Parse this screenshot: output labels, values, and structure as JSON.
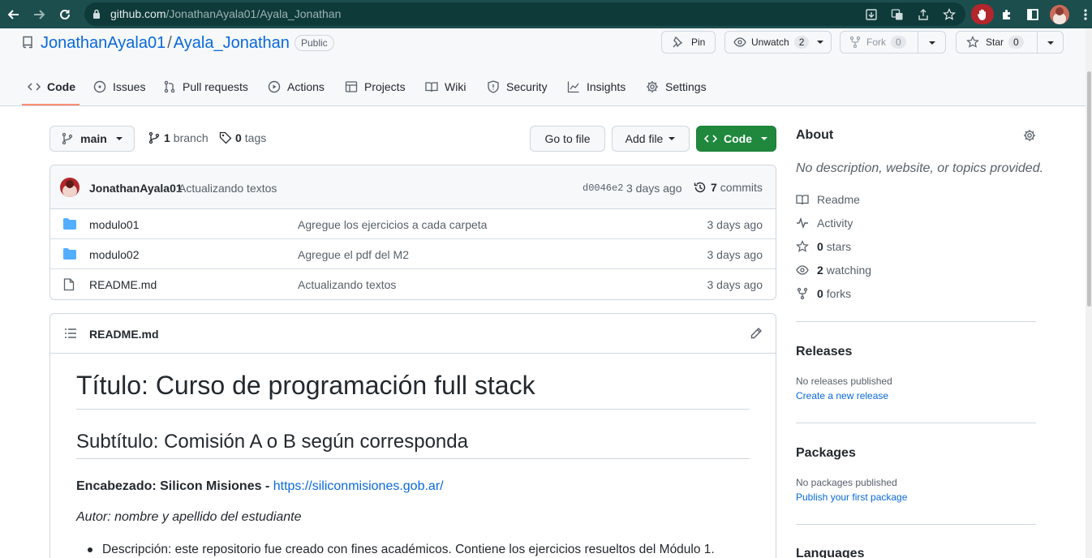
{
  "browser": {
    "url_host": "github.com",
    "url_path": "/JonathanAyala01/Ayala_Jonathan"
  },
  "repo": {
    "owner": "JonathanAyala01",
    "separator": "/",
    "name": "Ayala_Jonathan",
    "visibility": "Public",
    "pin_label": "Pin",
    "unwatch_label": "Unwatch",
    "unwatch_count": "2",
    "fork_label": "Fork",
    "fork_count": "0",
    "star_label": "Star",
    "star_count": "0"
  },
  "tabs": [
    {
      "label": "Code"
    },
    {
      "label": "Issues"
    },
    {
      "label": "Pull requests"
    },
    {
      "label": "Actions"
    },
    {
      "label": "Projects"
    },
    {
      "label": "Wiki"
    },
    {
      "label": "Security"
    },
    {
      "label": "Insights"
    },
    {
      "label": "Settings"
    }
  ],
  "file_nav": {
    "branch": "main",
    "branch_count": "1",
    "branch_label": "branch",
    "tag_count": "0",
    "tag_label": "tags",
    "goto_label": "Go to file",
    "add_file_label": "Add file",
    "code_label": "Code"
  },
  "commit": {
    "author": "JonathanAyala01",
    "message": "Actualizando textos",
    "sha": "d0046e2",
    "age": "3 days ago",
    "commit_count": "7",
    "commit_label": "commits"
  },
  "files": [
    {
      "name": "modulo01",
      "type": "folder",
      "message": "Agregue los ejercicios a cada carpeta",
      "age": "3 days ago"
    },
    {
      "name": "modulo02",
      "type": "folder",
      "message": "Agregue el pdf del M2",
      "age": "3 days ago"
    },
    {
      "name": "README.md",
      "type": "file",
      "message": "Actualizando textos",
      "age": "3 days ago"
    }
  ],
  "readme": {
    "filename": "README.md",
    "h1": "Título: Curso de programación full stack",
    "h2": "Subtítulo: Comisión A o B según corresponda",
    "header_label": "Encabezado: Silicon Misiones - ",
    "header_link": "https://siliconmisiones.gob.ar/",
    "author_line": "Autor: nombre y apellido del estudiante",
    "bullet": "Descripción: este repositorio fue creado con fines académicos. Contiene los ejercicios resueltos del Módulo 1."
  },
  "about": {
    "title": "About",
    "description": "No description, website, or topics provided.",
    "readme": "Readme",
    "activity": "Activity",
    "stars_count": "0",
    "stars_label": "stars",
    "watching_count": "2",
    "watching_label": "watching",
    "forks_count": "0",
    "forks_label": "forks"
  },
  "releases": {
    "title": "Releases",
    "empty": "No releases published",
    "link": "Create a new release"
  },
  "packages": {
    "title": "Packages",
    "empty": "No packages published",
    "link": "Publish your first package"
  },
  "languages": {
    "title": "Languages"
  },
  "colors": {
    "browser_bar": "#1c4e4e",
    "link": "#0969da",
    "primary_button": "#1f883d",
    "tab_underline": "#fd8c73"
  }
}
